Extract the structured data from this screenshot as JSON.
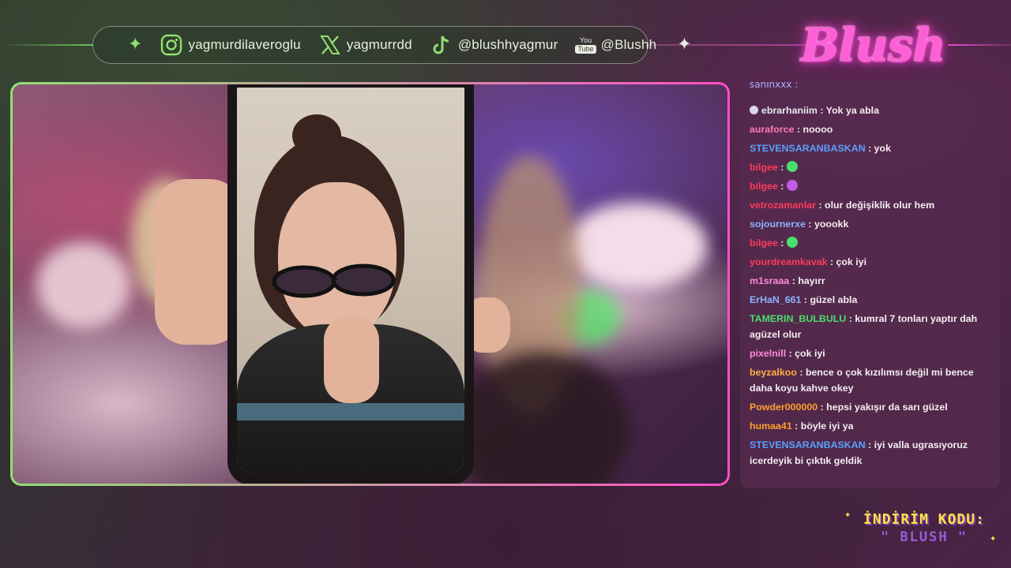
{
  "socials": [
    {
      "platform": "instagram",
      "icon": "instagram-icon",
      "handle": "yagmurdilaveroglu"
    },
    {
      "platform": "x",
      "icon": "x-icon",
      "handle": "yagmurrdd"
    },
    {
      "platform": "tiktok",
      "icon": "tiktok-icon",
      "handle": "@blushhyagmur"
    },
    {
      "platform": "youtube",
      "icon": "youtube-icon",
      "handle": "@Blushh",
      "badge_top": "You",
      "badge_bottom": "Tube"
    }
  ],
  "logo": {
    "text": "Blush"
  },
  "chat": {
    "clipped_top": "sahinxxx :",
    "messages": [
      {
        "user": "ebrarhaniim",
        "color": "#e8e8f0",
        "text": "Yok ya abla",
        "badge": true
      },
      {
        "user": "auraforce",
        "color": "#ff7ab0",
        "text": "noooo"
      },
      {
        "user": "STEVENSARANBASKAN",
        "color": "#5aa0ff",
        "text": "yok"
      },
      {
        "user": "bilgee",
        "color": "#ff3a5a",
        "text": "",
        "emote": "green"
      },
      {
        "user": "bilgee",
        "color": "#ff3a5a",
        "text": "",
        "emote": "purple"
      },
      {
        "user": "vetrozamanlar",
        "color": "#ff3a5a",
        "text": "olur değişiklik olur hem"
      },
      {
        "user": "sojournerxe",
        "color": "#8ab4ff",
        "text": "yoookk"
      },
      {
        "user": "bilgee",
        "color": "#ff3a5a",
        "text": "",
        "emote": "green"
      },
      {
        "user": "yourdreamkavak",
        "color": "#ff3a5a",
        "text": "çok iyi"
      },
      {
        "user": "m1sraaa",
        "color": "#ff8ad8",
        "text": "hayırr"
      },
      {
        "user": "ErHaN_661",
        "color": "#8ab4ff",
        "text": "güzel abla"
      },
      {
        "user": "TAMERIN_BULBULU",
        "color": "#4adf6a",
        "text": "kumral 7 tonları yaptır dah agüzel olur"
      },
      {
        "user": "pixelnill",
        "color": "#ff8ad8",
        "text": "çok iyi"
      },
      {
        "user": "beyzalkoo",
        "color": "#ffb040",
        "text": "bence o çok kızılımsı değil mi bence daha koyu kahve okey"
      },
      {
        "user": "Powder000000",
        "color": "#ffa030",
        "text": "hepsi yakışır da sarı güzel"
      },
      {
        "user": "humaa41",
        "color": "#ffa030",
        "text": "böyle iyi ya"
      },
      {
        "user": "STEVENSARANBASKAN",
        "color": "#5aa0ff",
        "text": "iyi valla ugrasıyoruz icerdeyik bi çıktık geldik"
      }
    ]
  },
  "promo": {
    "line1": "İNDİRİM KODU:",
    "line2": "\" BLUSH \""
  },
  "colors": {
    "accent_green": "#8fe070",
    "accent_pink": "#ff4fc8",
    "promo_yellow": "#ffe34a"
  }
}
